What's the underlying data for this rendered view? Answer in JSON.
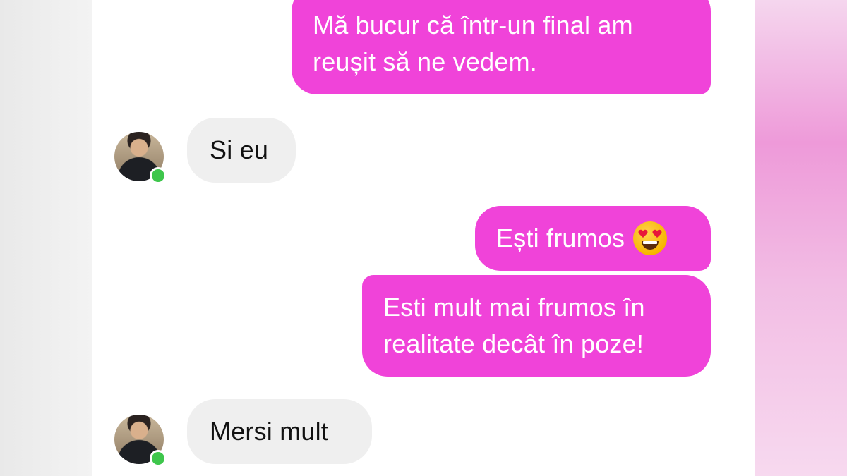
{
  "messages": [
    {
      "id": "m1",
      "side": "sent",
      "lines": [
        "Mă bucur că într-un final am",
        "reușit să ne vedem."
      ]
    },
    {
      "id": "m2",
      "side": "received",
      "text": "Si eu"
    },
    {
      "id": "m3",
      "side": "sent",
      "text": "Ești frumos",
      "emoji": "smiling-face-with-heart-eyes"
    },
    {
      "id": "m4",
      "side": "sent",
      "lines": [
        "Esti mult mai frumos în",
        "realitate decât în poze!"
      ]
    },
    {
      "id": "m5",
      "side": "received",
      "text": "Mersi mult"
    }
  ],
  "colors": {
    "sent_bubble": "#f043d9",
    "received_bubble": "#efefef",
    "online_indicator": "#3ec64c",
    "chat_background": "#ffffff"
  }
}
